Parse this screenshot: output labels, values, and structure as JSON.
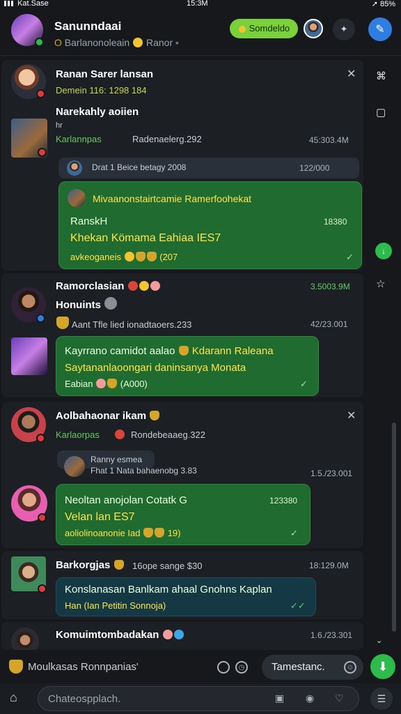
{
  "status_bar": {
    "carrier": "Kat.Sase",
    "time": "15:3M",
    "battery": "85%"
  },
  "header": {
    "title": "Sanunndaai",
    "subtitle": "Barlanonoleain",
    "subtitle2": "Ranor",
    "pill_label": "Somdeldo"
  },
  "chats": [
    {
      "name": "Ranan Sarer lansan",
      "line1": "Demein 116: 1298 184",
      "sender": "Narekahly aoiien",
      "sender_tag": "hr",
      "meta": "Karlannpas",
      "meta2": "Radenaelerg.292",
      "time": "45:303.4M",
      "quote_text": "Drat 1 Beice betagy 2008",
      "quote_time": "122/000",
      "bubble_title": "Mivaanonstairtcamie Ramerfoohekat",
      "bubble_line1": "RanskH",
      "bubble_time": "18380",
      "bubble_line2": "Khekan Kömama Eahiaa IES7",
      "bubble_line3": "avkeoganeis",
      "bubble_tail": "(207"
    },
    {
      "name": "Ramorclasian",
      "name2": "Honuints",
      "time": "3.5003.9M",
      "meta": "Aant Tfle lied ionadtaoers.233",
      "time2": "42/23.001",
      "bubble_line1": "Kayrrano camidot aalao",
      "bubble_line1b": "Kdarann Raleana",
      "bubble_line2": "Saytananlaoongari daninsanya Monata",
      "bubble_line3": "Eabian",
      "bubble_tail": "(A000)"
    },
    {
      "name": "Aolbahaonar ikam",
      "meta": "Karlaorpas",
      "meta2": "Rondebeaaeg.322",
      "quote_name": "Ranny esmea",
      "quote_text": "Fhat 1 Nata bahaenobg 3.83",
      "quote_time": "1.5./23.001",
      "bubble_line1": "Neoltan anojolan Cotatk G",
      "bubble_time": "123380",
      "bubble_line2": "Velan lan ES7",
      "bubble_line3": "aoliolinoanonie Iad",
      "bubble_tail": "19)"
    },
    {
      "name": "Barkorgjas",
      "meta": "16ope sange $30",
      "time": "18:129.0M",
      "bubble_line1": "Konslanasan Banlkam ahaal Gnohns Kaplan",
      "bubble_line2": "Han (Ian Petitin Sonnoja)"
    },
    {
      "name": "Komuimtombadakan",
      "time": "1.6./23.301"
    }
  ],
  "composer": {
    "text": "Moulkasas Ronnpanias'",
    "button_label": "Tamestanc."
  },
  "bottomnav": {
    "search_placeholder": "Chateospplach."
  },
  "colors": {
    "accent_green": "#7ad13b",
    "bubble_green": "#1f6b30",
    "link_blue": "#2f7de1"
  }
}
